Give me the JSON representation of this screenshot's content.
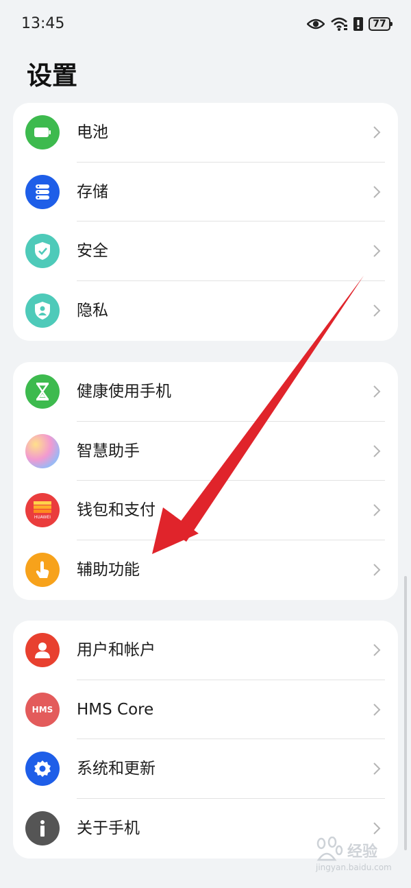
{
  "status": {
    "time": "13:45",
    "battery": "77"
  },
  "title": "设置",
  "groups": [
    {
      "items": [
        {
          "label": "电池",
          "icon": "battery-icon",
          "color": "#3dba4e"
        },
        {
          "label": "存储",
          "icon": "storage-icon",
          "color": "#1e5ee8"
        },
        {
          "label": "安全",
          "icon": "shield-check-icon",
          "color": "#4ecab9"
        },
        {
          "label": "隐私",
          "icon": "privacy-shield-icon",
          "color": "#4ecab9"
        }
      ]
    },
    {
      "items": [
        {
          "label": "健康使用手机",
          "icon": "hourglass-icon",
          "color": "#3dba4e"
        },
        {
          "label": "智慧助手",
          "icon": "assistant-orb-icon",
          "color": "#b79ef0"
        },
        {
          "label": "钱包和支付",
          "icon": "wallet-icon",
          "color": "#ea3d3d"
        },
        {
          "label": "辅助功能",
          "icon": "hand-touch-icon",
          "color": "#f7a21b"
        }
      ]
    },
    {
      "items": [
        {
          "label": "用户和帐户",
          "icon": "user-icon",
          "color": "#e8402f"
        },
        {
          "label": "HMS Core",
          "icon": "hms-icon",
          "color": "#e35b5b",
          "icon_text": "HMS"
        },
        {
          "label": "系统和更新",
          "icon": "gear-icon",
          "color": "#1e5ee8"
        },
        {
          "label": "关于手机",
          "icon": "info-icon",
          "color": "#555555"
        }
      ]
    }
  ],
  "wallet_brand": "HUAWEI",
  "watermark": {
    "text": "经验",
    "sub": "jingyan.baidu.com"
  }
}
